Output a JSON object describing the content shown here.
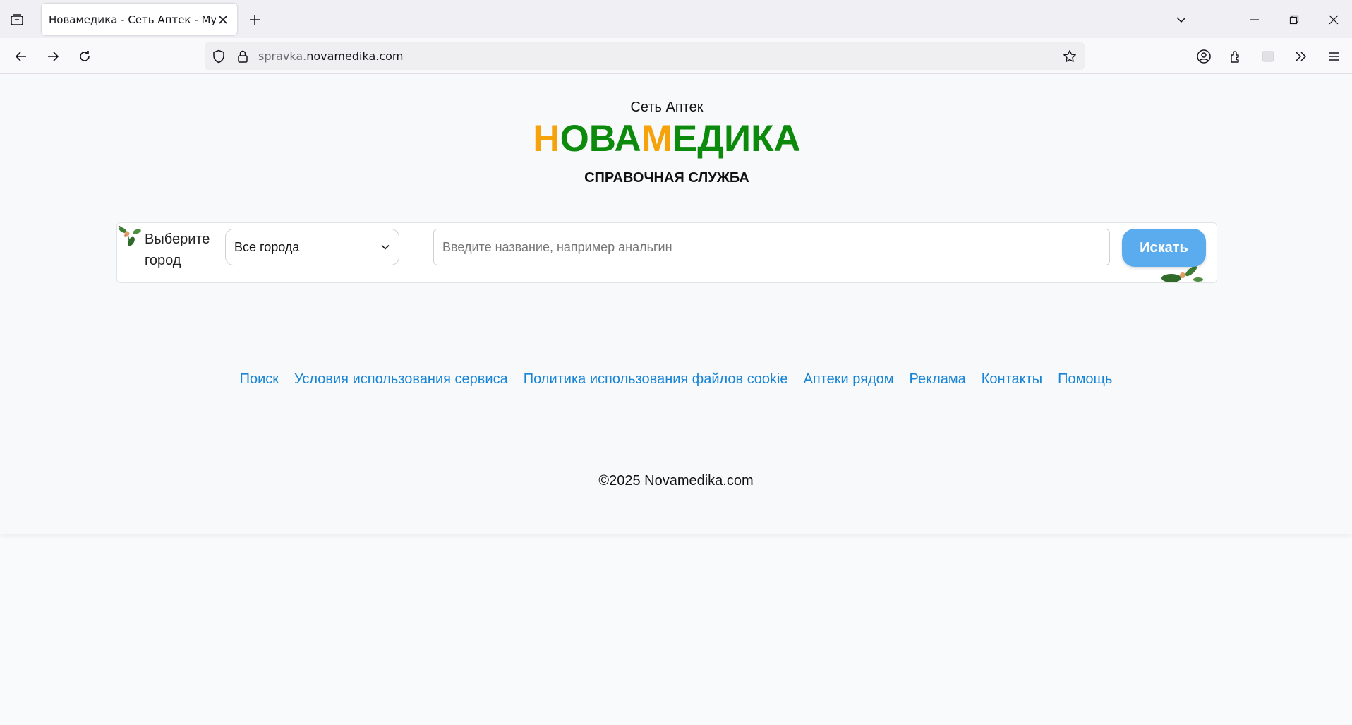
{
  "browser": {
    "tab_title": "Новамедика - Сеть Аптек - MySite",
    "url_prefix": "spravka.",
    "url_domain": "novamedika.com"
  },
  "header": {
    "subtitle": "Сеть Аптек",
    "logo_parts": [
      "Н",
      "ОВА",
      "М",
      "ЕДИКА"
    ],
    "service": "СПРАВОЧНАЯ СЛУЖБА",
    "colors": {
      "orange": "#f5a20b",
      "green": "#0b8a0b"
    }
  },
  "search": {
    "city_label": "Выберите город",
    "city_value": "Все города",
    "query_placeholder": "Введите название, например анальгин",
    "button_label": "Искать"
  },
  "footer": {
    "links": [
      "Поиск",
      "Условия использования сервиса",
      "Политика использования файлов cookie",
      "Аптеки рядом",
      "Реклама",
      "Контакты",
      "Помощь"
    ],
    "copyright": "©2025 Novamedika.com"
  }
}
